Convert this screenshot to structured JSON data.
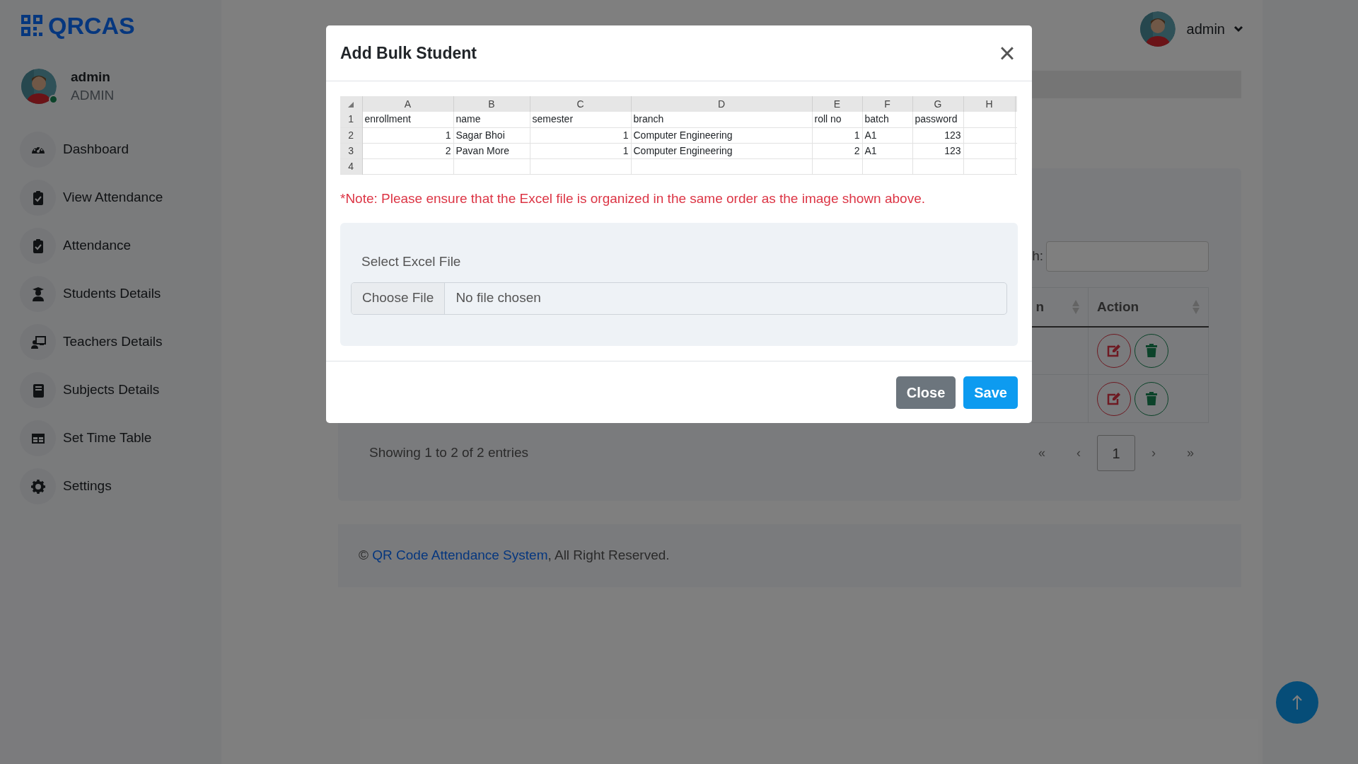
{
  "sidebar": {
    "logo": "QRCAS",
    "user": {
      "name": "admin",
      "role": "ADMIN",
      "online": true
    },
    "items": [
      {
        "label": "Dashboard",
        "kind": "gauge"
      },
      {
        "label": "View Attendance",
        "kind": "clipboard"
      },
      {
        "label": "Attendance",
        "kind": "clipboard"
      },
      {
        "label": "Students Details",
        "kind": "student"
      },
      {
        "label": "Teachers Details",
        "kind": "teacher"
      },
      {
        "label": "Subjects Details",
        "kind": "book"
      },
      {
        "label": "Set Time Table",
        "kind": "table"
      },
      {
        "label": "Settings",
        "kind": "gear"
      }
    ]
  },
  "header": {
    "user": "admin"
  },
  "table": {
    "search_label": "h:",
    "columns": [
      "n",
      "Action"
    ],
    "rows": [
      {
        "kind": "actions"
      },
      {
        "kind": "actions"
      }
    ],
    "info": "Showing 1 to 2 of 2 entries",
    "pagination": [
      {
        "label": "«",
        "selected": false
      },
      {
        "label": "‹",
        "selected": false
      },
      {
        "label": "1",
        "selected": true
      },
      {
        "label": "›",
        "selected": false
      },
      {
        "label": "»",
        "selected": false
      }
    ]
  },
  "footer": {
    "symbol": "©",
    "link": "QR Code Attendance System",
    "text": ", All Right Reserved."
  },
  "modal": {
    "title": "Add Bulk Student",
    "close_icon": "×",
    "sample_sheet": {
      "columns": [
        "A",
        "B",
        "C",
        "D",
        "E",
        "F",
        "G",
        "H"
      ],
      "rows": [
        {
          "number": "1",
          "cells": [
            "enrollment",
            "name",
            "semester",
            "branch",
            "roll no",
            "batch",
            "password"
          ]
        },
        {
          "number": "2",
          "cells": [
            "1",
            "Sagar Bhoi",
            "1",
            "Computer Engineering",
            "1",
            "A1",
            "123"
          ]
        },
        {
          "number": "3",
          "cells": [
            "2",
            "Pavan More",
            "1",
            "Computer Engineering",
            "2",
            "A1",
            "123"
          ]
        },
        {
          "number": "4",
          "cells": []
        }
      ]
    },
    "note": "*Note: Please ensure that the Excel file is organized in the same order as the image shown above.",
    "file_label": "Select Excel File",
    "choose_button": "Choose File",
    "file_status": "No file chosen",
    "buttons": [
      {
        "label": "Close",
        "kind": "secondary"
      },
      {
        "label": "Save",
        "kind": "primary"
      }
    ]
  }
}
